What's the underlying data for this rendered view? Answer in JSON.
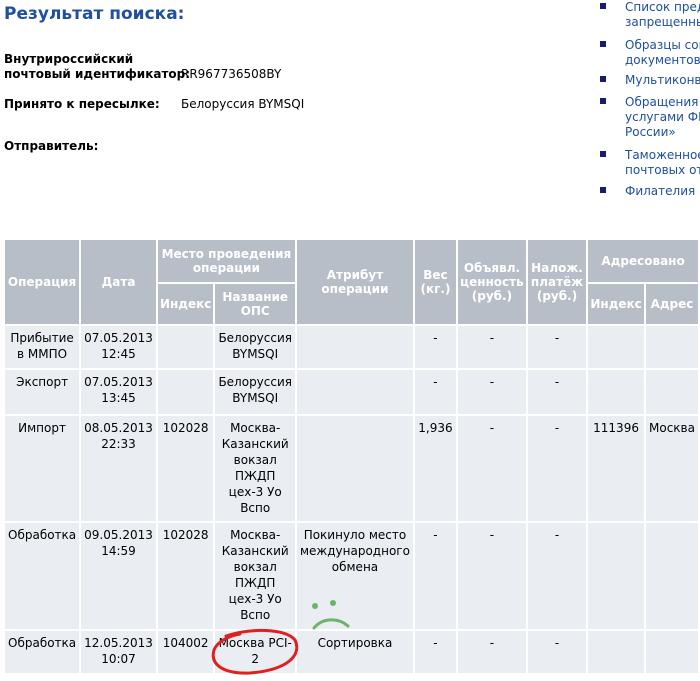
{
  "page": {
    "title": "Результат поиска:"
  },
  "info": {
    "id_label_1": "Внутрироссийский",
    "id_label_2": "почтовый идентификатор:",
    "id_value": "RR967736508BY",
    "accepted_label": "Принято к пересылке:",
    "accepted_value": "Белоруссия BYMSQI",
    "sender_label": "Отправитель:"
  },
  "links": [
    {
      "lines": "Список предм\nзапрещенных"
    },
    {
      "lines": "Образцы соп\nдокументов"
    },
    {
      "lines": "Мультиконве"
    },
    {
      "lines": "Обращения п\nуслугами ФГУ\nРоссии»"
    },
    {
      "lines": "Таможенное\nпочтовых отп"
    },
    {
      "lines": "Филателия"
    }
  ],
  "table": {
    "headers": {
      "operation": "Операция",
      "date": "Дата",
      "place": "Место проведения операции",
      "index": "Индекс",
      "ops_name": "Название ОПС",
      "attribute": "Атрибут операции",
      "weight": "Вес (кг.)",
      "declared": "Объявл. ценность (руб.)",
      "cod": "Налож. платёж (руб.)",
      "addressed": "Адресовано",
      "addr_index": "Индекс",
      "addr": "Адрес"
    },
    "rows": [
      {
        "op": "Прибытие в ММПО",
        "date": "07.05.2013 12:45",
        "index": "",
        "name": "Белоруссия BYMSQI",
        "attr": "",
        "weight": "-",
        "declared": "-",
        "cod": "-",
        "aindex": "",
        "addr": ""
      },
      {
        "op": "Экспорт",
        "date": "07.05.2013 13:45",
        "index": "",
        "name": "Белоруссия BYMSQI",
        "attr": "",
        "weight": "-",
        "declared": "-",
        "cod": "-",
        "aindex": "",
        "addr": ""
      },
      {
        "op": "Импорт",
        "date": "08.05.2013 22:33",
        "index": "102028",
        "name": "Москва-Казанский вокзал ПЖДП цех-3 Уо Вспо",
        "attr": "",
        "weight": "1,936",
        "declared": "-",
        "cod": "-",
        "aindex": "111396",
        "addr": "Москва"
      },
      {
        "op": "Обработка",
        "date": "09.05.2013 14:59",
        "index": "102028",
        "name": "Москва-Казанский вокзал ПЖДП цех-3 Уо Вспо",
        "attr": "Покинуло место международного обмена",
        "weight": "-",
        "declared": "-",
        "cod": "-",
        "aindex": "",
        "addr": ""
      },
      {
        "op": "Обработка",
        "date": "12.05.2013 10:07",
        "index": "104002",
        "name": "Москва PCI-2",
        "attr": "Сортировка",
        "weight": "-",
        "declared": "-",
        "cod": "-",
        "aindex": "",
        "addr": ""
      }
    ]
  },
  "annotation_colors": {
    "circle": "#e02020",
    "face": "#6cb36c"
  }
}
